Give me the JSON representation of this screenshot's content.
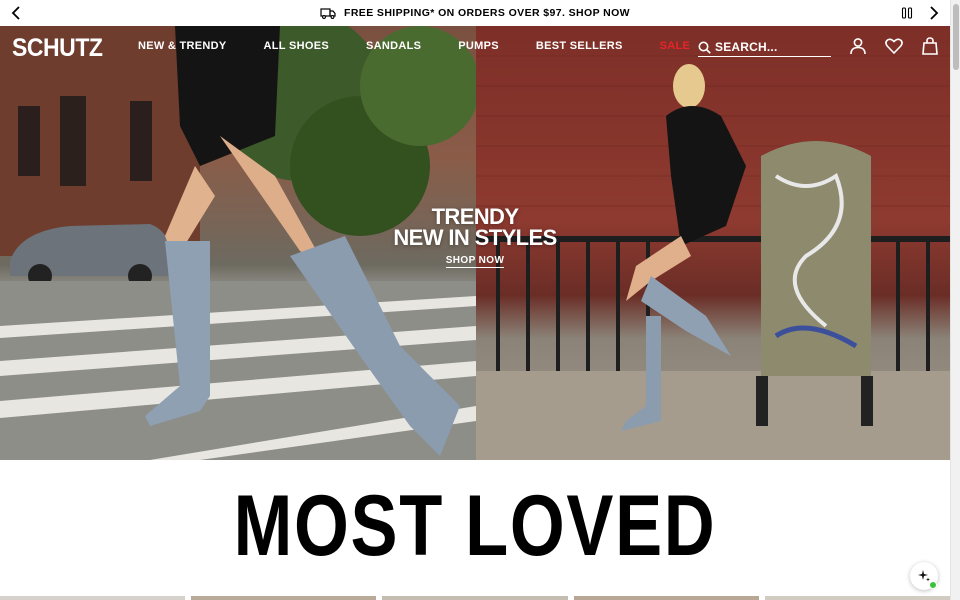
{
  "promo": {
    "message": "FREE SHIPPING* ON ORDERS OVER $97. SHOP NOW",
    "icons": [
      "chevron-left-icon",
      "truck-icon",
      "pause-icon",
      "chevron-right-icon"
    ]
  },
  "header": {
    "logo": "SCHUTZ",
    "nav": [
      "NEW & TRENDY",
      "ALL SHOES",
      "SANDALS",
      "PUMPS",
      "BEST SELLERS",
      "SALE"
    ],
    "sale_color": "#e8242a",
    "search_placeholder": "SEARCH...",
    "icons": [
      "search-icon",
      "account-icon",
      "wishlist-icon",
      "bag-icon"
    ]
  },
  "hero": {
    "headline_line1": "TRENDY",
    "headline_line2": "NEW IN STYLES",
    "cta": "SHOP NOW"
  },
  "section": {
    "title": "MOST LOVED"
  },
  "colors": {
    "text": "#000000",
    "background": "#ffffff",
    "sale": "#e8242a"
  }
}
